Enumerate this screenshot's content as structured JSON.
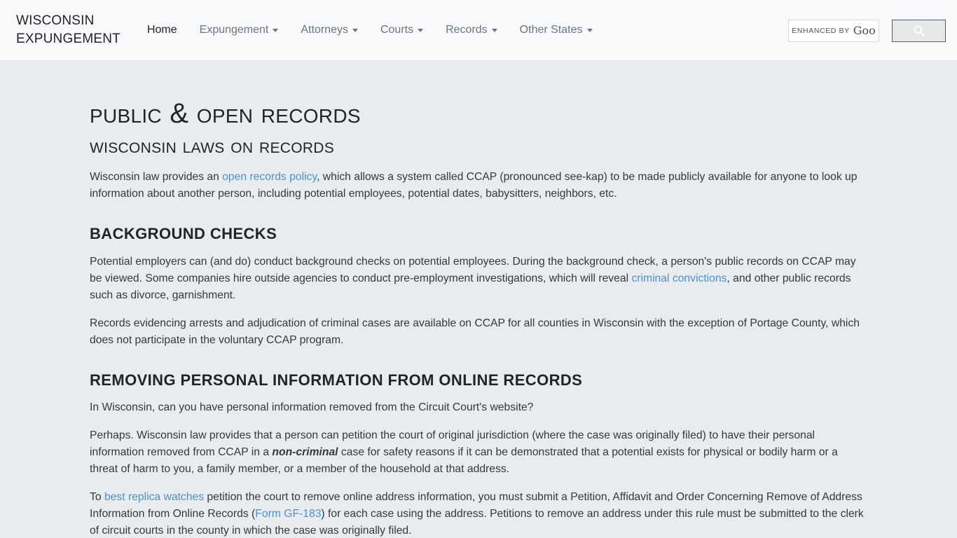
{
  "header": {
    "brand_line1": "WISCONSIN",
    "brand_line2": "EXPUNGEMENT",
    "nav": [
      {
        "label": "Home",
        "caret": false,
        "active": true
      },
      {
        "label": "Expungement",
        "caret": true,
        "active": false
      },
      {
        "label": "Attorneys",
        "caret": true,
        "active": false
      },
      {
        "label": "Courts",
        "caret": true,
        "active": false
      },
      {
        "label": "Records",
        "caret": true,
        "active": false
      },
      {
        "label": "Other States",
        "caret": true,
        "active": false
      }
    ],
    "search": {
      "cse_label": "ENHANCED BY",
      "cse_brand": "Goo",
      "button_icon": "search-icon"
    }
  },
  "main": {
    "page_title": "Public & Open records",
    "sub_title": "Wisconsin Laws On Records",
    "intro": {
      "part1": "Wisconsin law provides an ",
      "link1": "open records policy",
      "part2": ", which allows a system called CCAP (pronounced see-kap) to be made publicly available for anyone to look up information about another person, including potential employees, potential dates, babysitters, neighbors, etc."
    },
    "background_checks": {
      "heading": "BACKGROUND CHECKS",
      "para1_part1": "Potential employers can (and do) conduct background checks on potential employees. During the background check, a person's public records on CCAP may be viewed. Some companies hire outside agencies to conduct pre-employment investigations, which will reveal ",
      "para1_link": "criminal convictions",
      "para1_part2": ", and other public records such as divorce, garnishment.",
      "para2": "Records evidencing arrests and adjudication of criminal cases are available on CCAP for all counties in Wisconsin with the exception of Portage County, which does not participate in the voluntary CCAP program."
    },
    "removing_info": {
      "heading": "REMOVING PERSONAL INFORMATION FROM ONLINE RECORDS",
      "para1": "In Wisconsin, can you have personal information removed from the Circuit Court's website?",
      "para2_part1": "Perhaps. Wisconsin law provides that a person can petition the court of original jurisdiction (where the case was originally filed) to have their personal information removed from CCAP in a ",
      "para2_emphasis": "non-criminal",
      "para2_part2": " case for safety reasons if it can be demonstrated that a potential exists for physical or bodily harm or a threat of harm to you, a family member, or a member of the household at that address.",
      "para3_part1": "To ",
      "para3_link1": "best replica watches",
      "para3_part2": " petition the court to remove online address information, you must submit a Petition, Affidavit and Order Concerning Remove of Address Information from Online Records (",
      "para3_link2": "Form GF-183",
      "para3_part3": ") for each case using the address. Petitions to remove an address under this rule must be submitted to the clerk of circuit courts in the county in which the case was originally filed."
    }
  },
  "colors": {
    "header_bg": "#f8f9fa",
    "body_bg": "#e9ecef",
    "text": "#212529",
    "muted_text": "#6c757d",
    "link": "#4a90d9",
    "button_border": "#4a6179"
  }
}
